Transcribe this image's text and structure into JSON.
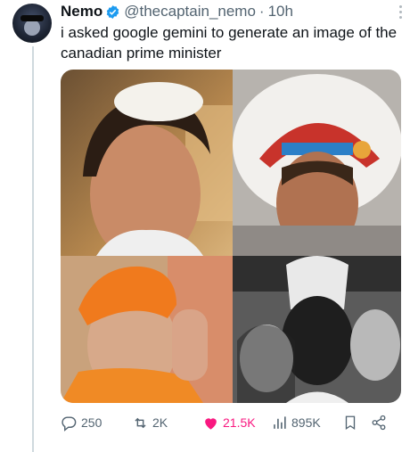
{
  "tweet": {
    "author_name": "Nemo",
    "author_handle": "@thecaptain_nemo",
    "separator": "·",
    "time": "10h",
    "text": "i asked google gemini to generate an image of the canadian prime minister"
  },
  "actions": {
    "replies": "250",
    "retweets": "2K",
    "likes": "21.5K",
    "views": "895K"
  },
  "colors": {
    "accent": "#1d9bf0",
    "like": "#f91880",
    "muted": "#536471"
  },
  "icons": [
    "verified-badge-icon",
    "more-icon",
    "reply-icon",
    "retweet-icon",
    "heart-icon",
    "views-icon",
    "bookmark-icon",
    "share-icon"
  ]
}
